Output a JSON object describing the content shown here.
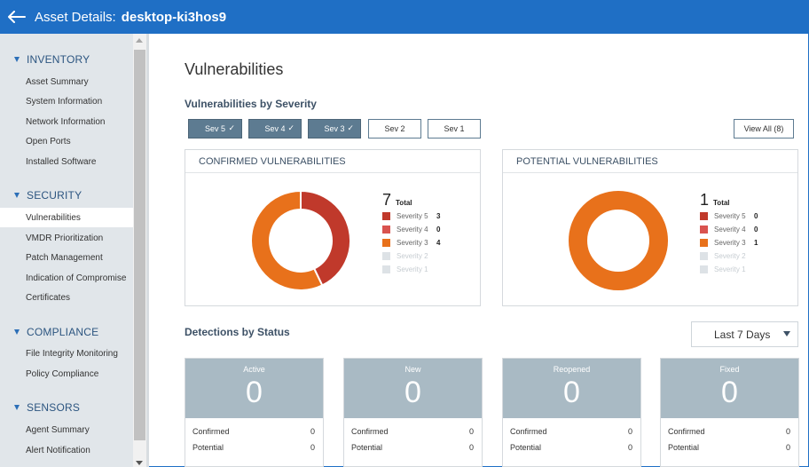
{
  "header": {
    "title": "Asset Details:",
    "host": "desktop-ki3hos9"
  },
  "sidebar": {
    "sections": [
      {
        "title": "INVENTORY",
        "items": [
          "Asset Summary",
          "System Information",
          "Network Information",
          "Open Ports",
          "Installed Software"
        ]
      },
      {
        "title": "SECURITY",
        "items": [
          "Vulnerabilities",
          "VMDR Prioritization",
          "Patch Management",
          "Indication of Compromise",
          "Certificates"
        ]
      },
      {
        "title": "COMPLIANCE",
        "items": [
          "File Integrity Monitoring",
          "Policy Compliance"
        ]
      },
      {
        "title": "SENSORS",
        "items": [
          "Agent Summary",
          "Alert Notification"
        ]
      }
    ],
    "active_item": "Vulnerabilities"
  },
  "page": {
    "title": "Vulnerabilities",
    "by_severity_heading": "Vulnerabilities by Severity",
    "severity_buttons": [
      {
        "label": "Sev 5",
        "selected": true
      },
      {
        "label": "Sev 4",
        "selected": true
      },
      {
        "label": "Sev 3",
        "selected": true
      },
      {
        "label": "Sev 2",
        "selected": false
      },
      {
        "label": "Sev 1",
        "selected": false
      }
    ],
    "view_all": "View All (8)",
    "check_glyph": "✓"
  },
  "severity_colors": {
    "Severity 5": "#c0392b",
    "Severity 4": "#d9534f",
    "Severity 3": "#e8711b",
    "Severity 2": "#dde2e6",
    "Severity 1": "#dde2e6"
  },
  "confirmed": {
    "title": "CONFIRMED VULNERABILITIES",
    "total": "7",
    "total_label": "Total",
    "legend": [
      {
        "name": "Severity 5",
        "count": "3",
        "value": 3
      },
      {
        "name": "Severity 4",
        "count": "0",
        "value": 0
      },
      {
        "name": "Severity 3",
        "count": "4",
        "value": 4
      },
      {
        "name": "Severity 2",
        "count": "",
        "value": 0
      },
      {
        "name": "Severity 1",
        "count": "",
        "value": 0
      }
    ]
  },
  "potential": {
    "title": "POTENTIAL VULNERABILITIES",
    "total": "1",
    "total_label": "Total",
    "legend": [
      {
        "name": "Severity 5",
        "count": "0",
        "value": 0
      },
      {
        "name": "Severity 4",
        "count": "0",
        "value": 0
      },
      {
        "name": "Severity 3",
        "count": "1",
        "value": 1
      },
      {
        "name": "Severity 2",
        "count": "",
        "value": 0
      },
      {
        "name": "Severity 1",
        "count": "",
        "value": 0
      }
    ]
  },
  "detections": {
    "heading": "Detections by Status",
    "range": "Last 7 Days",
    "cards": [
      {
        "label": "Active",
        "value": "0",
        "confirmed_label": "Confirmed",
        "confirmed": "0",
        "potential_label": "Potential",
        "potential": "0"
      },
      {
        "label": "New",
        "value": "0",
        "confirmed_label": "Confirmed",
        "confirmed": "0",
        "potential_label": "Potential",
        "potential": "0"
      },
      {
        "label": "Reopened",
        "value": "0",
        "confirmed_label": "Confirmed",
        "confirmed": "0",
        "potential_label": "Potential",
        "potential": "0"
      },
      {
        "label": "Fixed",
        "value": "0",
        "confirmed_label": "Confirmed",
        "confirmed": "0",
        "potential_label": "Potential",
        "potential": "0"
      }
    ]
  }
}
